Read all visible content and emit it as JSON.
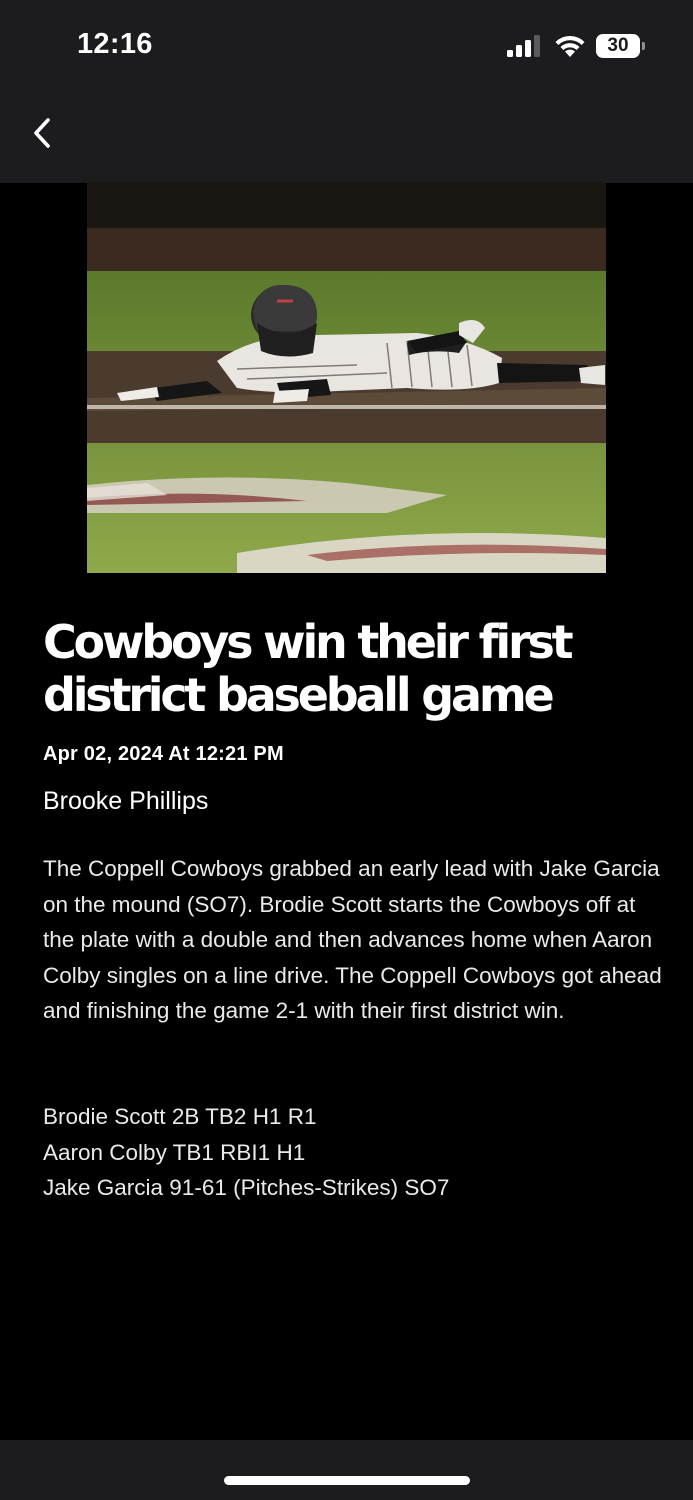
{
  "status_bar": {
    "time": "12:16",
    "battery": "30"
  },
  "nav": {
    "back_icon": "chevron-left-icon"
  },
  "article": {
    "headline": "Cowboys win their first district baseball game",
    "date": "Apr 02, 2024 At 12:21 PM",
    "author": "Brooke Phillips",
    "body": "The Coppell Cowboys grabbed an early lead with Jake Garcia on the mound (SO7). Brodie Scott starts the Cowboys off at the plate with a double and then advances home when Aaron Colby singles on a line drive. The Coppell Cowboys got ahead and finishing the game 2-1 with their first district win.",
    "stats": [
      "Brodie Scott 2B TB2 H1 R1",
      "Aaron Colby TB1 RBI1 H1",
      "Jake Garcia 91-61 (Pitches-Strikes) SO7"
    ]
  },
  "colors": {
    "background": "#000000",
    "top_bar": "#1c1c1e",
    "text": "#ffffff"
  }
}
